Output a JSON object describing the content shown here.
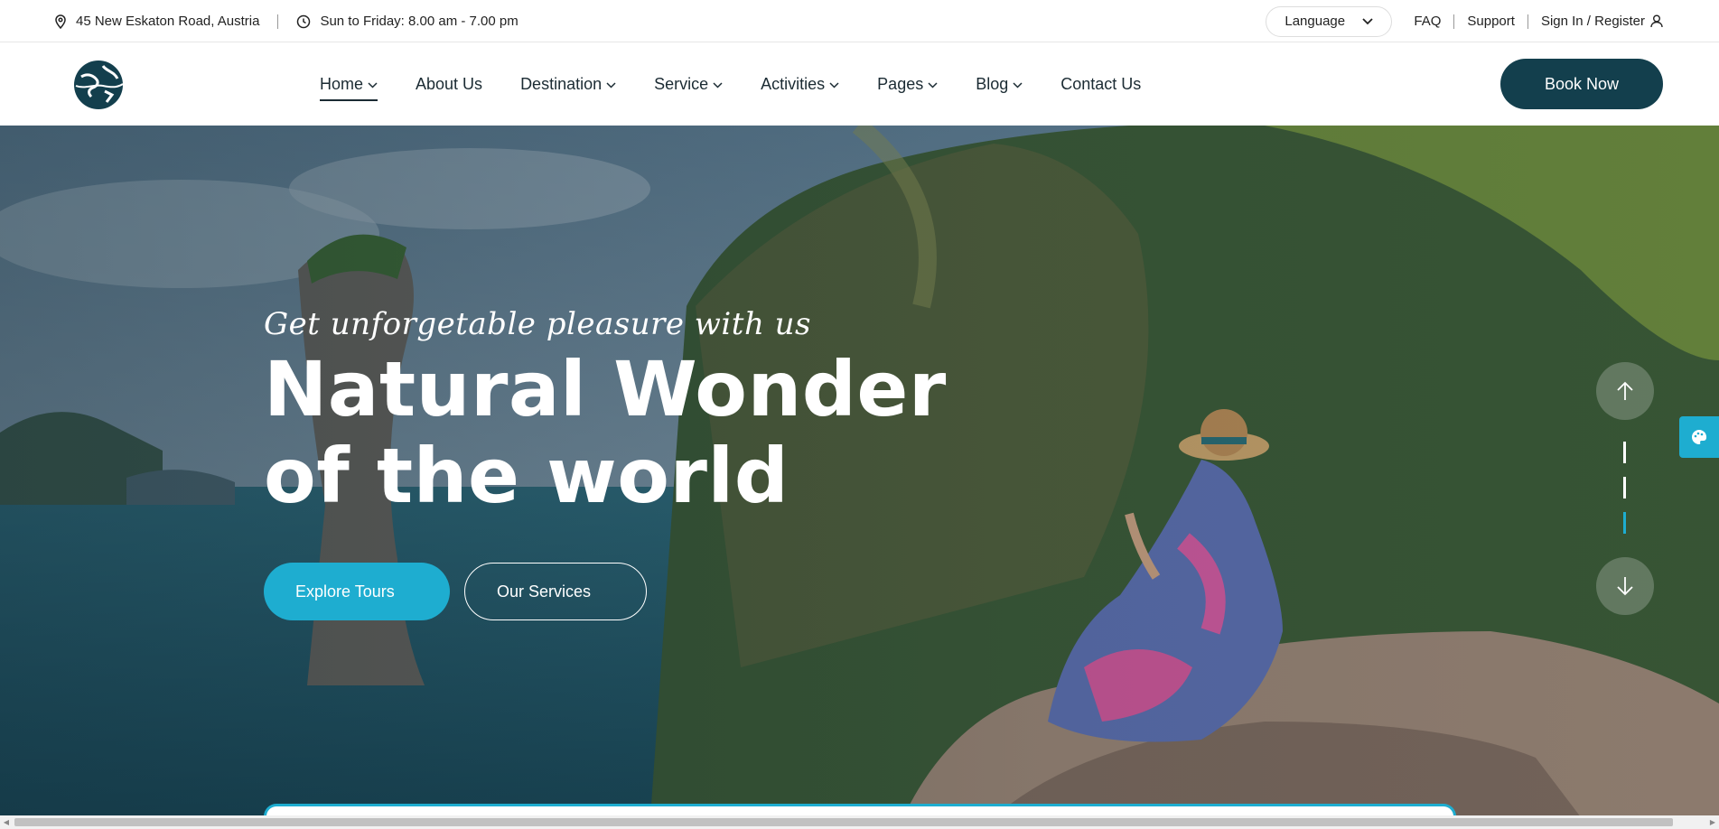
{
  "topbar": {
    "address": "45 New Eskaton Road, Austria",
    "hours": "Sun to Friday: 8.00 am - 7.00 pm",
    "language_label": "Language",
    "faq": "FAQ",
    "support": "Support",
    "signin": "Sign In / Register"
  },
  "nav": {
    "items": [
      {
        "label": "Home",
        "dropdown": true
      },
      {
        "label": "About Us",
        "dropdown": false
      },
      {
        "label": "Destination",
        "dropdown": true
      },
      {
        "label": "Service",
        "dropdown": true
      },
      {
        "label": "Activities",
        "dropdown": true
      },
      {
        "label": "Pages",
        "dropdown": true
      },
      {
        "label": "Blog",
        "dropdown": true
      },
      {
        "label": "Contact Us",
        "dropdown": false
      }
    ],
    "book_label": "Book Now"
  },
  "hero": {
    "tagline": "Get unforgetable pleasure with us",
    "title_line1": "Natural Wonder",
    "title_line2": "of the world",
    "explore_label": "Explore Tours",
    "services_label": "Our Services"
  },
  "colors": {
    "brand_dark": "#133f4d",
    "accent": "#1eadd0"
  },
  "icons": [
    "location-pin-icon",
    "clock-icon",
    "chevron-down-icon",
    "user-icon",
    "arrow-up-icon",
    "arrow-down-icon",
    "palette-icon"
  ]
}
